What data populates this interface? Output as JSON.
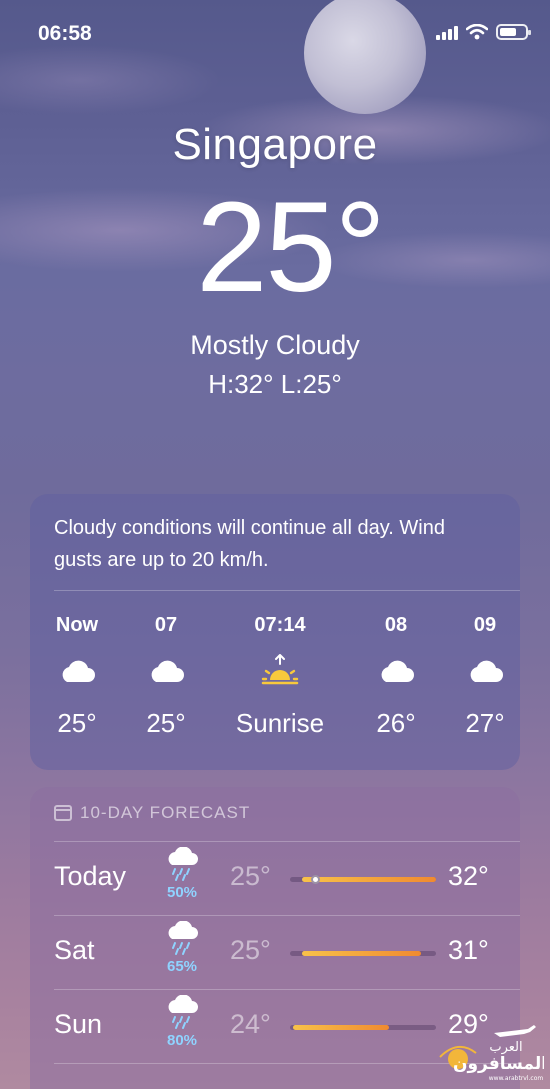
{
  "status": {
    "time": "06:58"
  },
  "weather": {
    "city": "Singapore",
    "temperature": "25°",
    "condition": "Mostly Cloudy",
    "high_low": "H:32°  L:25°"
  },
  "hourly": {
    "summary": "Cloudy conditions will continue all day. Wind gusts are up to 20 km/h.",
    "items": [
      {
        "label": "Now",
        "icon": "cloud-icon",
        "temp": "25°"
      },
      {
        "label": "07",
        "icon": "cloud-icon",
        "temp": "25°"
      },
      {
        "label": "07:14",
        "icon": "sunrise-icon",
        "temp": "Sunrise"
      },
      {
        "label": "08",
        "icon": "cloud-icon",
        "temp": "26°"
      },
      {
        "label": "09",
        "icon": "cloud-icon",
        "temp": "27°"
      }
    ]
  },
  "forecast": {
    "header": "10-DAY FORECAST",
    "days": [
      {
        "day": "Today",
        "icon": "cloud-rain-icon",
        "precip": "50%",
        "low": "25°",
        "high": "32°",
        "bar_start": 0.08,
        "bar_end": 1.0,
        "current": 0.17
      },
      {
        "day": "Sat",
        "icon": "cloud-rain-icon",
        "precip": "65%",
        "low": "25°",
        "high": "31°",
        "bar_start": 0.08,
        "bar_end": 0.9
      },
      {
        "day": "Sun",
        "icon": "cloud-rain-icon",
        "precip": "80%",
        "low": "24°",
        "high": "29°",
        "bar_start": 0.02,
        "bar_end": 0.68
      }
    ]
  },
  "colors": {
    "precip": "#8fd3ff",
    "bar_warm": "#f08a30",
    "bar_light": "#f8c24a"
  },
  "watermark": {
    "line1": "العرب",
    "line2": "المسافرون",
    "url": "www.arabtrvl.com"
  }
}
